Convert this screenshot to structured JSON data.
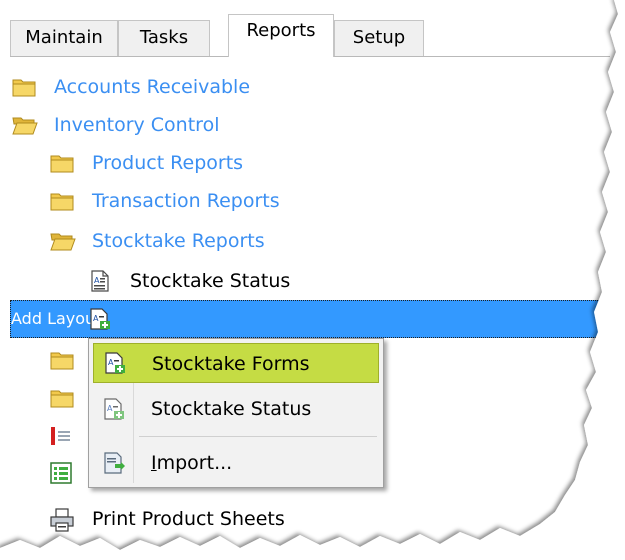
{
  "tabs": [
    {
      "label": "Maintain"
    },
    {
      "label": "Tasks"
    },
    {
      "label": "Reports",
      "active": true
    },
    {
      "label": "Setup"
    }
  ],
  "tree": {
    "accounts_receivable": "Accounts Receivable",
    "inventory_control": "Inventory Control",
    "product_reports": "Product Reports",
    "transaction_reports": "Transaction Reports",
    "stocktake_reports": "Stocktake Reports",
    "stocktake_status": "Stocktake Status",
    "add_layout": "Add Layout",
    "print_product_sheets": "Print Product Sheets"
  },
  "context_menu": {
    "items": [
      {
        "label": "Stocktake Forms",
        "highlighted": true
      },
      {
        "label": "Stocktake Status"
      },
      {
        "label": "Import..."
      }
    ]
  },
  "colors": {
    "link": "#3b8ff2",
    "selection": "#3399ff",
    "menu_highlight": "#c5dc44",
    "folder": "#f2c94c"
  }
}
